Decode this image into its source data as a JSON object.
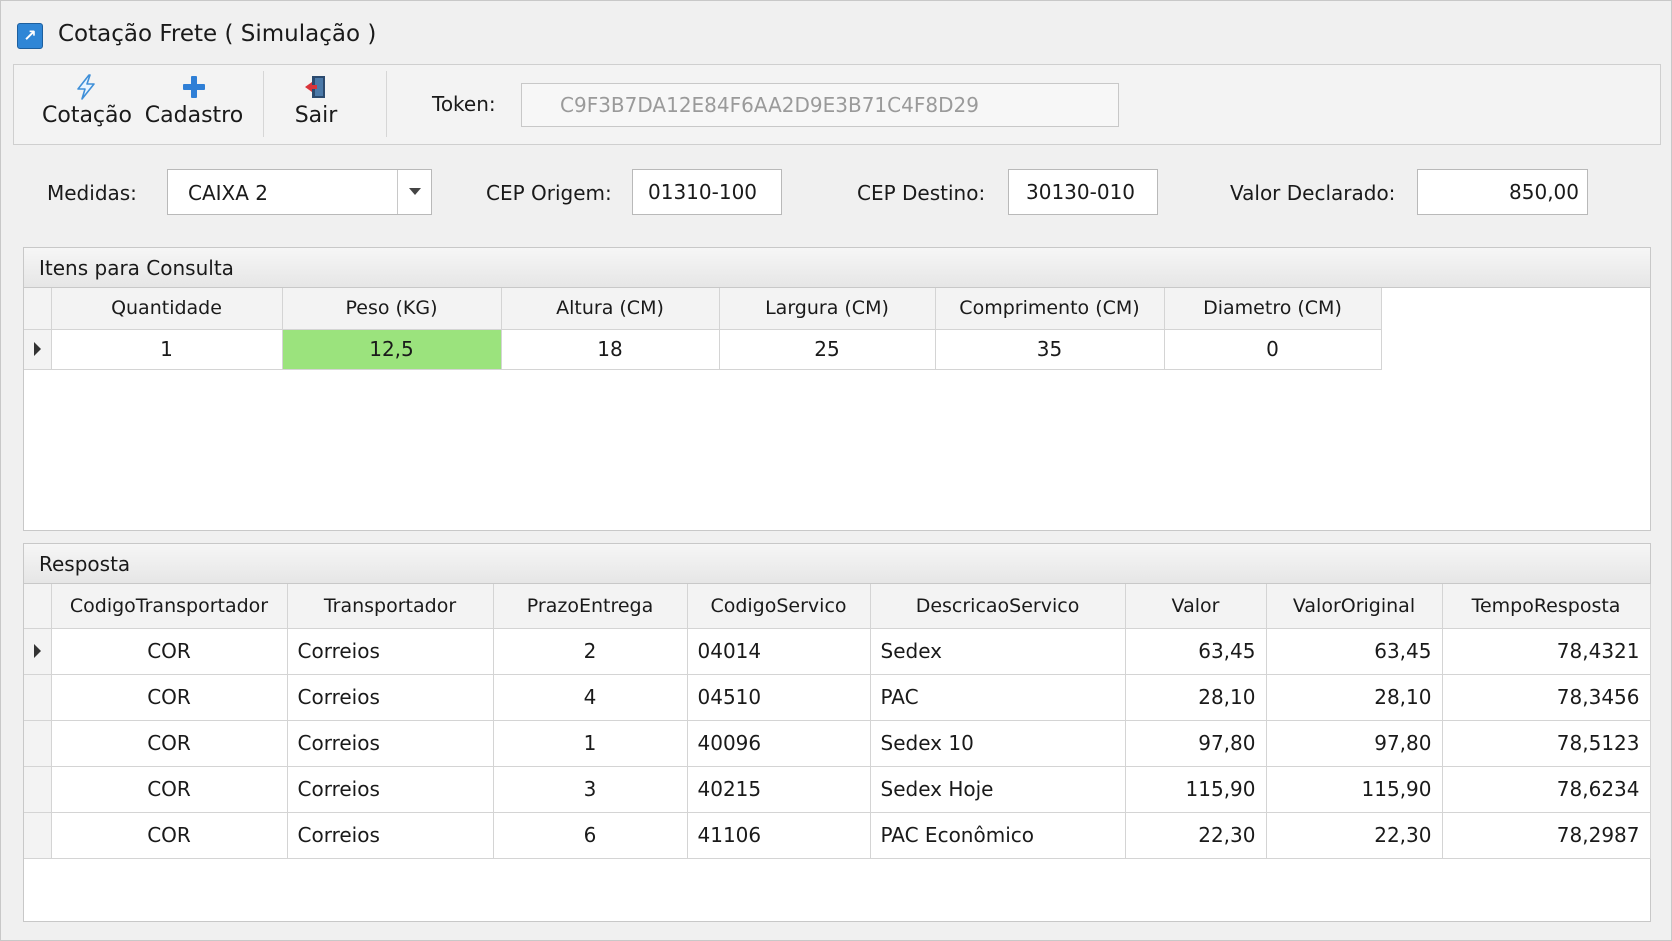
{
  "window": {
    "title": "Cotação Frete ( Simulação )",
    "app_icon": "chart-icon"
  },
  "toolbar": {
    "buttons": [
      {
        "label": "Cotação",
        "icon": "lightning-icon"
      },
      {
        "label": "Cadastro",
        "icon": "plus-icon"
      },
      {
        "label": "Sair",
        "icon": "exit-door-icon"
      }
    ],
    "token_label": "Token:",
    "token_value": "C9F3B7DA12E84F6AA2D9E3B71C4F8D29"
  },
  "form": {
    "medidas_label": "Medidas:",
    "medidas_value": "CAIXA 2",
    "cep_origem_label": "CEP Origem:",
    "cep_origem_value": "01310-100",
    "cep_destino_label": "CEP Destino:",
    "cep_destino_value": "30130-010",
    "valor_declarado_label": "Valor Declarado:",
    "valor_declarado_value": "850,00"
  },
  "itens": {
    "title": "Itens para Consulta",
    "columns": [
      "Quantidade",
      "Peso (KG)",
      "Altura (CM)",
      "Largura (CM)",
      "Comprimento (CM)",
      "Diametro (CM)"
    ],
    "rows": [
      [
        "1",
        "12,5",
        "18",
        "25",
        "35",
        "0"
      ]
    ],
    "highlight_color": "#9be37d"
  },
  "resposta": {
    "title": "Resposta",
    "columns": [
      "CodigoTransportador",
      "Transportador",
      "PrazoEntrega",
      "CodigoServico",
      "DescricaoServico",
      "Valor",
      "ValorOriginal",
      "TempoResposta"
    ],
    "rows": [
      [
        "COR",
        "Correios",
        "2",
        "04014",
        "Sedex",
        "63,45",
        "63,45",
        "78,4321"
      ],
      [
        "COR",
        "Correios",
        "4",
        "04510",
        "PAC",
        "28,10",
        "28,10",
        "78,3456"
      ],
      [
        "COR",
        "Correios",
        "1",
        "40096",
        "Sedex 10",
        "97,80",
        "97,80",
        "78,5123"
      ],
      [
        "COR",
        "Correios",
        "3",
        "40215",
        "Sedex Hoje",
        "115,90",
        "115,90",
        "78,6234"
      ],
      [
        "COR",
        "Correios",
        "6",
        "41106",
        "PAC Econômico",
        "22,30",
        "22,30",
        "78,2987"
      ]
    ]
  }
}
